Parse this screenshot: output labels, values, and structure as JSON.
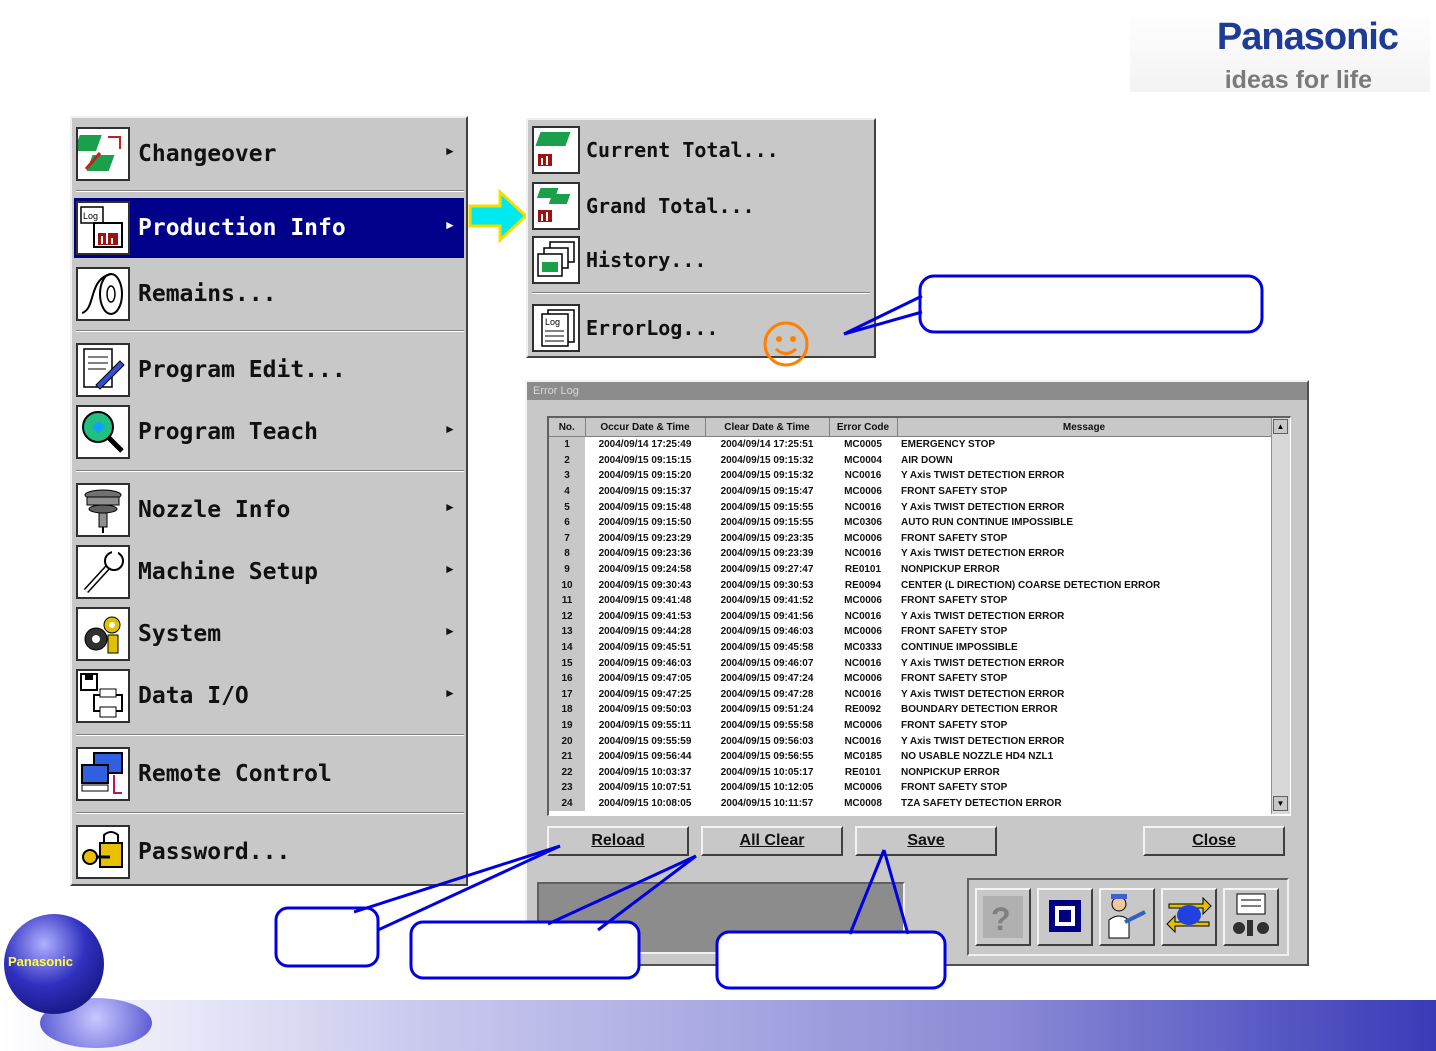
{
  "brand": {
    "name": "Panasonic",
    "tagline": "ideas for life"
  },
  "main_menu": {
    "items": [
      {
        "label": "Changeover",
        "submenu": true
      },
      {
        "label": "Production Info",
        "submenu": true,
        "selected": true
      },
      {
        "label": "Remains...",
        "submenu": false
      },
      {
        "label": "Program Edit...",
        "submenu": false
      },
      {
        "label": "Program Teach",
        "submenu": true
      },
      {
        "label": "Nozzle Info",
        "submenu": true
      },
      {
        "label": "Machine Setup",
        "submenu": true
      },
      {
        "label": "System",
        "submenu": true
      },
      {
        "label": "Data I/O",
        "submenu": true
      },
      {
        "label": "Remote Control",
        "submenu": false
      },
      {
        "label": "Password...",
        "submenu": false
      }
    ]
  },
  "sub_menu": {
    "items": [
      {
        "label": "Current Total..."
      },
      {
        "label": "Grand Total..."
      },
      {
        "label": "History..."
      },
      {
        "label": "ErrorLog..."
      }
    ]
  },
  "error_log": {
    "title": "Error Log",
    "columns": [
      "No.",
      "Occur Date & Time",
      "Clear Date & Time",
      "Error Code",
      "Message"
    ],
    "rows": [
      [
        "1",
        "2004/09/14 17:25:49",
        "2004/09/14 17:25:51",
        "MC0005",
        "EMERGENCY STOP"
      ],
      [
        "2",
        "2004/09/15 09:15:15",
        "2004/09/15 09:15:32",
        "MC0004",
        "AIR DOWN"
      ],
      [
        "3",
        "2004/09/15 09:15:20",
        "2004/09/15 09:15:32",
        "NC0016",
        "Y Axis TWIST DETECTION ERROR"
      ],
      [
        "4",
        "2004/09/15 09:15:37",
        "2004/09/15 09:15:47",
        "MC0006",
        "FRONT SAFETY STOP"
      ],
      [
        "5",
        "2004/09/15 09:15:48",
        "2004/09/15 09:15:55",
        "NC0016",
        "Y Axis TWIST DETECTION ERROR"
      ],
      [
        "6",
        "2004/09/15 09:15:50",
        "2004/09/15 09:15:55",
        "MC0306",
        "AUTO RUN CONTINUE IMPOSSIBLE"
      ],
      [
        "7",
        "2004/09/15 09:23:29",
        "2004/09/15 09:23:35",
        "MC0006",
        "FRONT SAFETY STOP"
      ],
      [
        "8",
        "2004/09/15 09:23:36",
        "2004/09/15 09:23:39",
        "NC0016",
        "Y Axis TWIST DETECTION ERROR"
      ],
      [
        "9",
        "2004/09/15 09:24:58",
        "2004/09/15 09:27:47",
        "RE0101",
        "NONPICKUP ERROR"
      ],
      [
        "10",
        "2004/09/15 09:30:43",
        "2004/09/15 09:30:53",
        "RE0094",
        "CENTER (L DIRECTION) COARSE DETECTION ERROR"
      ],
      [
        "11",
        "2004/09/15 09:41:48",
        "2004/09/15 09:41:52",
        "MC0006",
        "FRONT SAFETY STOP"
      ],
      [
        "12",
        "2004/09/15 09:41:53",
        "2004/09/15 09:41:56",
        "NC0016",
        "Y Axis TWIST DETECTION ERROR"
      ],
      [
        "13",
        "2004/09/15 09:44:28",
        "2004/09/15 09:46:03",
        "MC0006",
        "FRONT SAFETY STOP"
      ],
      [
        "14",
        "2004/09/15 09:45:51",
        "2004/09/15 09:45:58",
        "MC0333",
        "CONTINUE IMPOSSIBLE"
      ],
      [
        "15",
        "2004/09/15 09:46:03",
        "2004/09/15 09:46:07",
        "NC0016",
        "Y Axis TWIST DETECTION ERROR"
      ],
      [
        "16",
        "2004/09/15 09:47:05",
        "2004/09/15 09:47:24",
        "MC0006",
        "FRONT SAFETY STOP"
      ],
      [
        "17",
        "2004/09/15 09:47:25",
        "2004/09/15 09:47:28",
        "NC0016",
        "Y Axis TWIST DETECTION ERROR"
      ],
      [
        "18",
        "2004/09/15 09:50:03",
        "2004/09/15 09:51:24",
        "RE0092",
        "BOUNDARY DETECTION ERROR"
      ],
      [
        "19",
        "2004/09/15 09:55:11",
        "2004/09/15 09:55:58",
        "MC0006",
        "FRONT SAFETY STOP"
      ],
      [
        "20",
        "2004/09/15 09:55:59",
        "2004/09/15 09:56:03",
        "NC0016",
        "Y Axis TWIST DETECTION ERROR"
      ],
      [
        "21",
        "2004/09/15 09:56:44",
        "2004/09/15 09:56:55",
        "MC0185",
        "NO USABLE NOZZLE HD4 NZL1"
      ],
      [
        "22",
        "2004/09/15 10:03:37",
        "2004/09/15 10:05:17",
        "RE0101",
        "NONPICKUP ERROR"
      ],
      [
        "23",
        "2004/09/15 10:07:51",
        "2004/09/15 10:12:05",
        "MC0006",
        "FRONT SAFETY STOP"
      ],
      [
        "24",
        "2004/09/15 10:08:05",
        "2004/09/15 10:11:57",
        "MC0008",
        "TZA SAFETY DETECTION ERROR"
      ]
    ],
    "buttons": {
      "reload": "Reload",
      "all_clear": "All Clear",
      "save": "Save",
      "close": "Close"
    }
  },
  "footer": {
    "logo_text": "Panasonic"
  },
  "colors": {
    "menu_bg": "#c8c8c8",
    "selected": "#00008a",
    "callout": "#0000e0",
    "brand": "#1e3c96"
  }
}
